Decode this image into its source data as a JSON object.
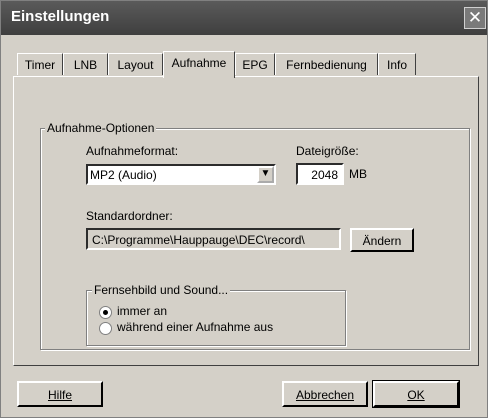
{
  "window": {
    "title": "Einstellungen",
    "close_symbol": "✕"
  },
  "tabs": [
    {
      "label": "Timer"
    },
    {
      "label": "LNB"
    },
    {
      "label": "Layout"
    },
    {
      "label": "Aufnahme",
      "active": true
    },
    {
      "label": "EPG"
    },
    {
      "label": "Fernbedienung"
    },
    {
      "label": "Info"
    }
  ],
  "group_recording": {
    "title": "Aufnahme-Optionen",
    "format_label": "Aufnahmeformat:",
    "format_value": "MP2 (Audio)",
    "size_label": "Dateigröße:",
    "size_value": "2048",
    "size_unit": "MB",
    "folder_label": "Standardordner:",
    "folder_value": "C:\\Programme\\Hauppauge\\DEC\\record\\",
    "change_button": "Ändern"
  },
  "group_tv_sound": {
    "title": "Fernsehbild und Sound...",
    "option_always": "immer an",
    "option_recording": "während einer Aufnahme aus",
    "selected": "immer an"
  },
  "footer": {
    "help": "Hilfe",
    "cancel": "Abbrechen",
    "ok": "OK"
  },
  "colors": {
    "dialog_bg": "#d4d0c8",
    "title_bg": "#4a4a4a"
  }
}
